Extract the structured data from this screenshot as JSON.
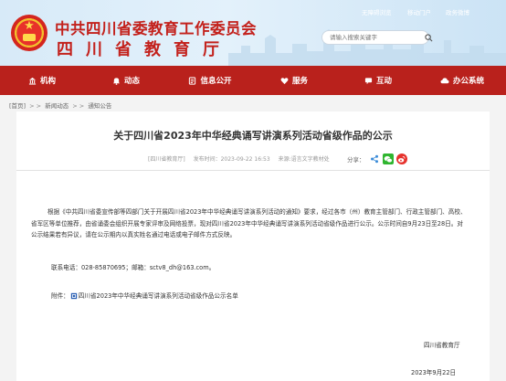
{
  "header": {
    "org_title": "中共四川省委教育工作委员会",
    "org_subtitle": "四川省教育厅",
    "top_links": [
      "无障碍浏览",
      "移动门户",
      "政务微博"
    ],
    "search_placeholder": "请输入搜索关键字"
  },
  "nav": {
    "items": [
      {
        "label": "机构",
        "icon": "bank-icon"
      },
      {
        "label": "动态",
        "icon": "bell-icon"
      },
      {
        "label": "信息公开",
        "icon": "document-icon"
      },
      {
        "label": "服务",
        "icon": "heart-icon"
      },
      {
        "label": "互动",
        "icon": "chat-icon"
      },
      {
        "label": "办公系统",
        "icon": "cloud-icon"
      }
    ]
  },
  "breadcrumb": {
    "home": "[首页]",
    "sep": "> >",
    "level1": "新闻动态",
    "level2": "通知公告"
  },
  "article": {
    "title": "关于四川省2023年中华经典诵写讲演系列活动省级作品的公示",
    "meta_source": "[四川省教育厅]",
    "meta_date": "发布时间：2023-09-22 16:53",
    "meta_origin": "来源:语言文字教材处",
    "share_label": "分享：",
    "paragraph": "根据《中共四川省委宣传部等四部门关于开展四川省2023年中华经典诵写讲演系列活动的通知》要求，经过各市（州）教育主管部门、行政主管部门、高校、省军区等单位推荐，由省诵委会组织开展专家评审及网络投票，现对四川省2023年中华经典诵写讲演系列活动省级作品进行公示。公示时间自9月23日至28日。对公示结果若有异议，请在公示期内以真实姓名通过电话或电子邮件方式反映。",
    "contact": "联系电话：028-85870695；邮箱：sctv8_dh@163.com。",
    "attachment_label": "附件：",
    "attachment_name": "四川省2023年中华经典诵写讲演系列活动省级作品公示名单",
    "sign_org": "四川省教育厅",
    "sign_date": "2023年9月22日"
  },
  "colors": {
    "brand_red": "#b9211c",
    "title_red": "#c3211c",
    "header_bg": "#d7eaf8"
  }
}
